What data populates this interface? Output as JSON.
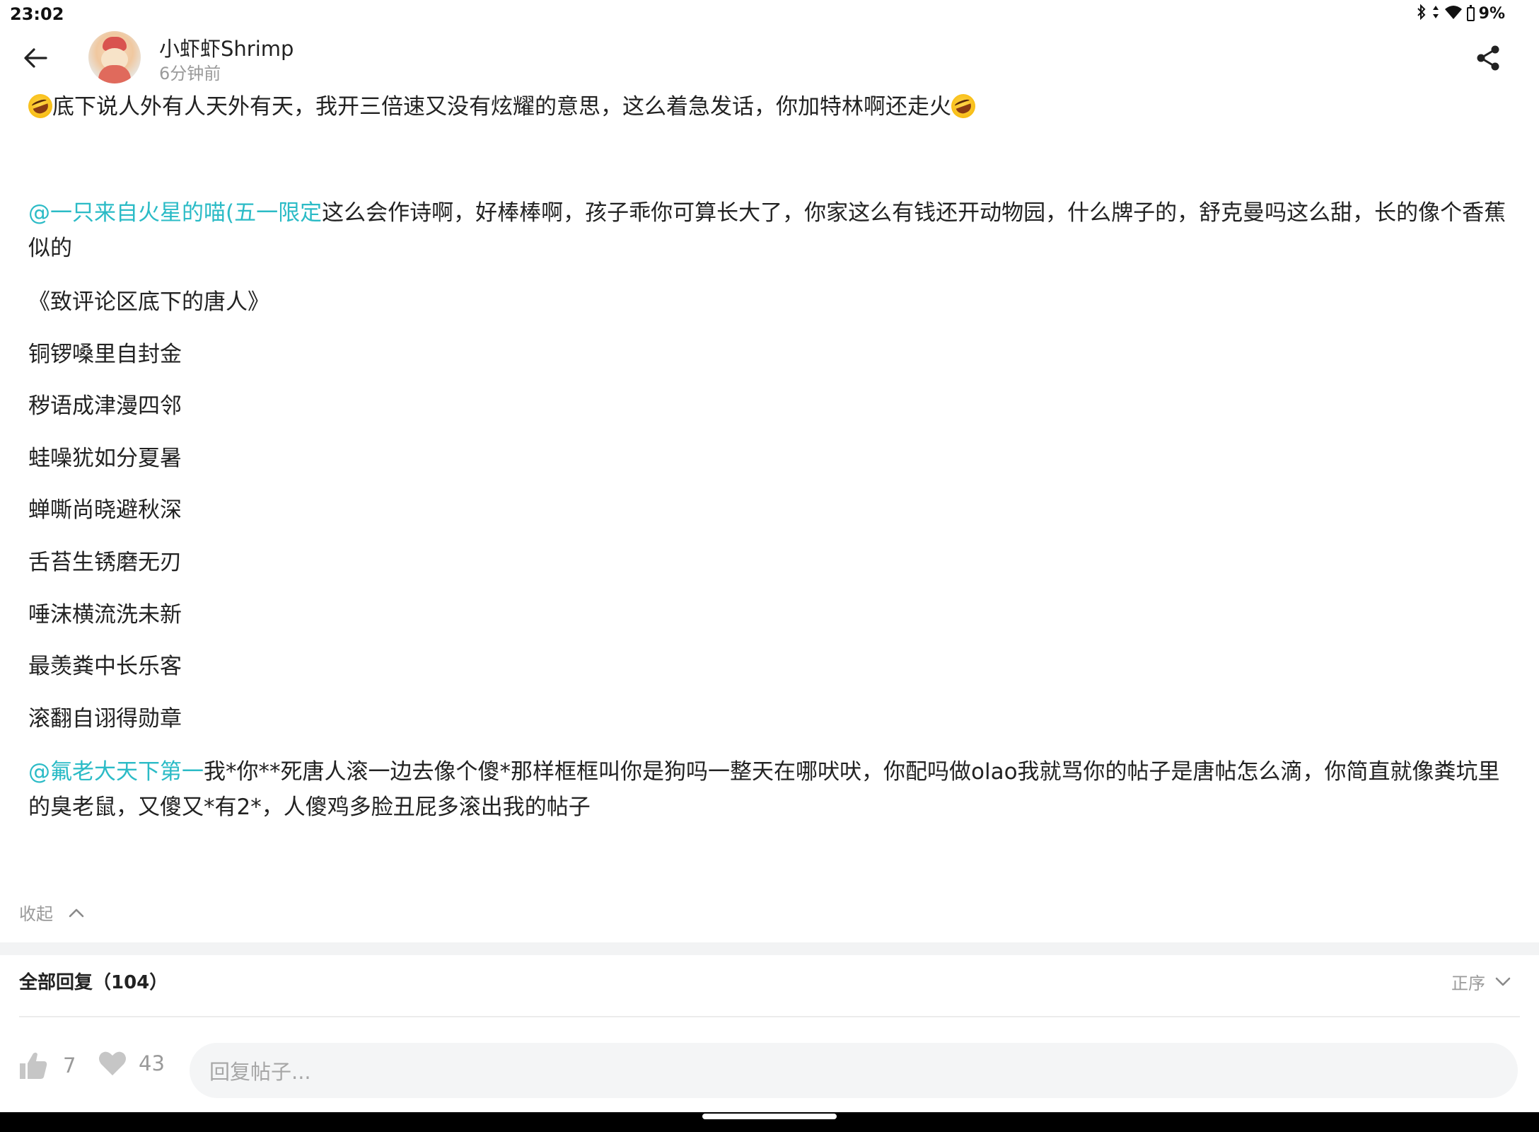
{
  "status_bar": {
    "time": "23:02",
    "battery": "9%",
    "icons": [
      "bluetooth-icon",
      "data-arrows-icon",
      "wifi-icon",
      "battery-icon"
    ]
  },
  "header": {
    "author_name": "小虾虾Shrimp",
    "post_time": "6分钟前",
    "icons": [
      "back-arrow-icon",
      "share-icon"
    ]
  },
  "post": {
    "first_line": "底下说人外有人天外有天，我开三倍速又没有炫耀的意思，这么着急发话，你加特林啊还走火",
    "mention1": "@一只来自火星的喵(五一限定",
    "mention1_text": "这么会作诗啊，好棒棒啊，孩子乖你可算长大了，你家这么有钱还开动物园，什么牌子的，舒克曼吗这么甜，长的像个香蕉似的",
    "poem_title": "《致评论区底下的唐人》",
    "poem_lines": [
      "铜锣嗓里自封金",
      "秽语成津漫四邻",
      "蛙噪犹如分夏暑",
      "蝉嘶尚晓避秋深",
      "舌苔生锈磨无刃",
      "唾沫横流洗未新",
      "最羡粪中长乐客",
      "滚翻自诩得勋章"
    ],
    "mention2": "@氟老大天下第一",
    "mention2_text": "我*你**死唐人滚一边去像个傻*那样框框叫你是狗吗一整天在哪吠吠，你配吗做olao我就骂你的帖子是唐帖怎么滴，你简直就像粪坑里的臭老鼠，又傻又*有2*，人傻鸡多脸丑屁多滚出我的帖子"
  },
  "collapse": {
    "label": "收起"
  },
  "replies": {
    "title": "全部回复（104）",
    "sort_label": "正序"
  },
  "actions": {
    "like_count": "7",
    "favorite_count": "43",
    "reply_placeholder": "回复帖子..."
  },
  "colors": {
    "mention": "#2bbbc6",
    "muted": "#9a9a9a",
    "band": "#f2f3f4"
  }
}
